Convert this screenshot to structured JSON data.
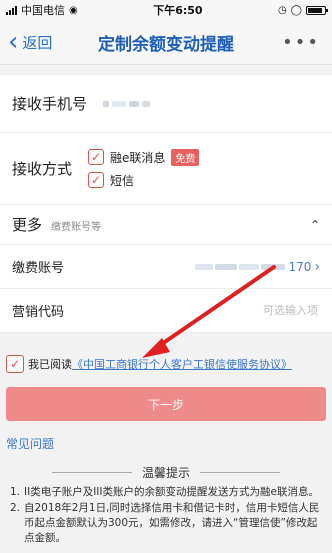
{
  "status_bar": {
    "carrier": "中国电信",
    "time": "下午6:50"
  },
  "nav": {
    "back_label": "返回",
    "title": "定制余额变动提醒",
    "more": "•••"
  },
  "form": {
    "phone_label": "接收手机号",
    "method_label": "接收方式",
    "method_options": [
      {
        "label": "融e联消息",
        "badge": "免费",
        "checked": true
      },
      {
        "label": "短信",
        "checked": true
      }
    ],
    "more_label": "更多",
    "more_sub": "缴费账号等",
    "account_label": "缴费账号",
    "account_suffix": "170",
    "promo_label": "营销代码",
    "promo_placeholder": "可选输入项"
  },
  "agreement": {
    "prefix": "我已阅读",
    "link": "《中国工商银行个人客户工银信使服务协议》"
  },
  "next_button": "下一步",
  "faq": "常见问题",
  "tips": {
    "title": "温馨提示",
    "items": [
      "II类电子账户及III类账户的余额变动提醒发送方式为融e联消息。",
      "自2018年2月1日,同时选择信用卡和借记卡时，信用卡短信人民币起点金额默认为300元，如需修改，请进入“管理信使”修改起点金额。"
    ]
  },
  "colors": {
    "accent_blue": "#1f5fb8",
    "link_blue": "#3b78c9",
    "checkbox_red": "#d9534f",
    "button_pink": "#f08b8b",
    "annotation_arrow": "#e02020"
  }
}
